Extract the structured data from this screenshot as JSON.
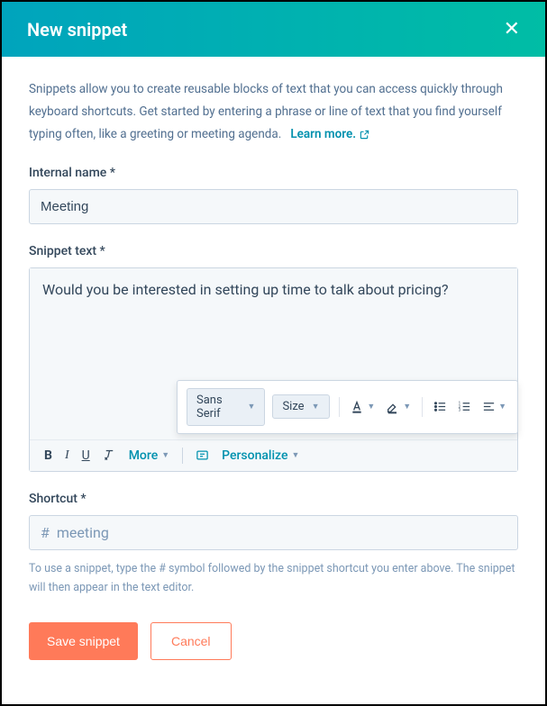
{
  "header": {
    "title": "New snippet"
  },
  "intro": {
    "text": "Snippets allow you to create reusable blocks of text that you can access quickly through keyboard shortcuts. Get started by entering a phrase or line of text that you find yourself typing often, like a greeting or meeting agenda.",
    "learn_more": "Learn more."
  },
  "fields": {
    "internal_name": {
      "label": "Internal name *",
      "value": "Meeting"
    },
    "snippet_text": {
      "label": "Snippet text *",
      "value": "Would you be interested in setting up time to talk about pricing?"
    },
    "shortcut": {
      "label": "Shortcut *",
      "prefix": "#",
      "value": "meeting",
      "hint": "To use a snippet, type the # symbol followed by the snippet shortcut you enter above. The snippet will then appear in the text editor."
    }
  },
  "toolbar": {
    "more": "More",
    "personalize": "Personalize"
  },
  "popover": {
    "font": "Sans Serif",
    "size": "Size"
  },
  "actions": {
    "save": "Save snippet",
    "cancel": "Cancel"
  }
}
